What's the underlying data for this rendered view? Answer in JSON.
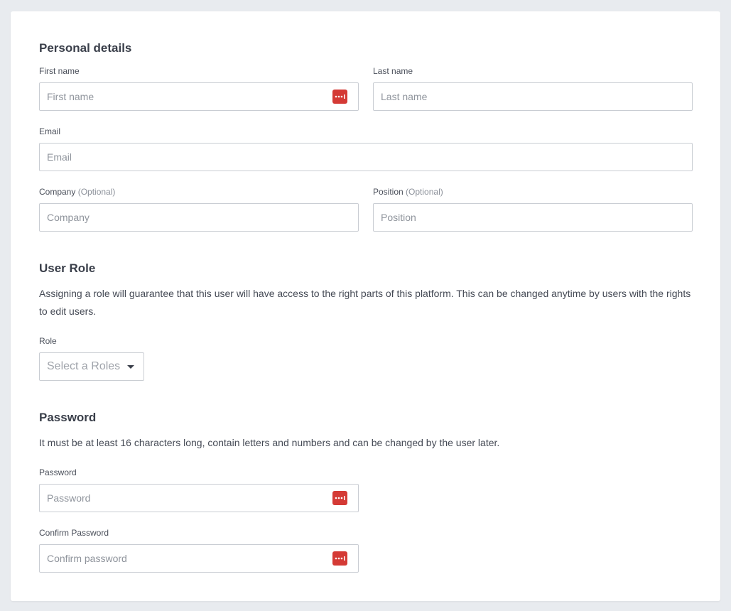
{
  "personal": {
    "title": "Personal details",
    "first_name": {
      "label": "First name",
      "placeholder": "First name"
    },
    "last_name": {
      "label": "Last name",
      "placeholder": "Last name"
    },
    "email": {
      "label": "Email",
      "placeholder": "Email"
    },
    "company": {
      "label": "Company",
      "optional": "(Optional)",
      "placeholder": "Company"
    },
    "position": {
      "label": "Position",
      "optional": "(Optional)",
      "placeholder": "Position"
    }
  },
  "role": {
    "title": "User Role",
    "description": "Assigning a role will guarantee that this user will have access to the right parts of this platform. This can be changed anytime by users with the rights to edit users.",
    "label": "Role",
    "select_placeholder": "Select a Roles"
  },
  "password": {
    "title": "Password",
    "description": "It must be at least 16 characters long, contain letters and numbers and can be changed by the user later.",
    "password": {
      "label": "Password",
      "placeholder": "Password"
    },
    "confirm": {
      "label": "Confirm Password",
      "placeholder": "Confirm password"
    }
  },
  "icons": {
    "password_manager": "password-manager-icon"
  },
  "colors": {
    "page_bg": "#e8ebef",
    "card_bg": "#ffffff",
    "input_border": "#c9cdd3",
    "password_icon": "#d43a35"
  }
}
